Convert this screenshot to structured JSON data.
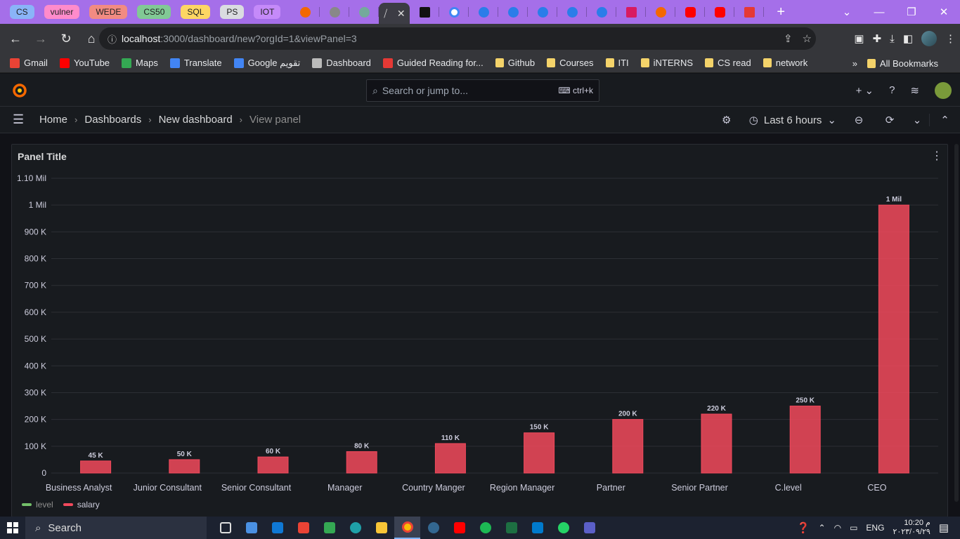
{
  "browser": {
    "tab_groups": [
      {
        "label": "CS",
        "color": "#8ab4f8"
      },
      {
        "label": "vulner",
        "color": "#ff8bcb"
      },
      {
        "label": "WEDE",
        "color": "#f28b82"
      },
      {
        "label": "CS50",
        "color": "#81c995"
      },
      {
        "label": "SQL",
        "color": "#fdd663"
      },
      {
        "label": "PS",
        "color": "#dadce0"
      },
      {
        "label": "IOT",
        "color": "#c58af9"
      }
    ],
    "url_host": "localhost",
    "url_rest": ":3000/dashboard/new?orgId=1&viewPanel=3",
    "all_bookmarks_label": "All Bookmarks"
  },
  "bookmarks": [
    {
      "label": "Gmail",
      "icon": "gmail-icon",
      "color": "#ea4335"
    },
    {
      "label": "YouTube",
      "icon": "youtube-icon",
      "color": "#ff0000"
    },
    {
      "label": "Maps",
      "icon": "maps-icon",
      "color": "#34a853"
    },
    {
      "label": "Translate",
      "icon": "translate-icon",
      "color": "#4285f4"
    },
    {
      "label": "Google تقويم",
      "icon": "calendar-icon",
      "color": "#4285f4"
    },
    {
      "label": "Dashboard",
      "icon": "dashboard-icon",
      "color": "#bbbbbb"
    },
    {
      "label": "Guided Reading for...",
      "icon": "s-icon",
      "color": "#e53935"
    },
    {
      "label": "Github",
      "icon": "folder-icon",
      "color": "#f4d36a"
    },
    {
      "label": "Courses",
      "icon": "folder-icon",
      "color": "#f4d36a"
    },
    {
      "label": "ITI",
      "icon": "folder-icon",
      "color": "#f4d36a"
    },
    {
      "label": "iNTERNS",
      "icon": "folder-icon",
      "color": "#f4d36a"
    },
    {
      "label": "CS read",
      "icon": "folder-icon",
      "color": "#f4d36a"
    },
    {
      "label": "network",
      "icon": "folder-icon",
      "color": "#f4d36a"
    }
  ],
  "grafana": {
    "search_placeholder": "Search or jump to...",
    "search_shortcut": "ctrl+k",
    "breadcrumbs": [
      "Home",
      "Dashboards",
      "New dashboard",
      "View panel"
    ],
    "time_range": "Last 6 hours",
    "panel_title": "Panel Title"
  },
  "chart_data": {
    "type": "bar",
    "categories": [
      "Business Analyst",
      "Junior Consultant",
      "Senior Consultant",
      "Manager",
      "Country Manger",
      "Region Manager",
      "Partner",
      "Senior Partner",
      "C.level",
      "CEO"
    ],
    "series": [
      {
        "name": "level",
        "color": "#73bf69",
        "values": []
      },
      {
        "name": "salary",
        "color": "#f2495c",
        "values": [
          45000,
          50000,
          60000,
          80000,
          110000,
          150000,
          200000,
          220000,
          250000,
          1000000
        ]
      }
    ],
    "value_labels": [
      "45 K",
      "50 K",
      "60 K",
      "80 K",
      "110 K",
      "150 K",
      "200 K",
      "220 K",
      "250 K",
      "1 Mil"
    ],
    "ylim": [
      0,
      1100000
    ],
    "y_ticks": [
      {
        "value": 0,
        "label": "0"
      },
      {
        "value": 100000,
        "label": "100 K"
      },
      {
        "value": 200000,
        "label": "200 K"
      },
      {
        "value": 300000,
        "label": "300 K"
      },
      {
        "value": 400000,
        "label": "400 K"
      },
      {
        "value": 500000,
        "label": "500 K"
      },
      {
        "value": 600000,
        "label": "600 K"
      },
      {
        "value": 700000,
        "label": "700 K"
      },
      {
        "value": 800000,
        "label": "800 K"
      },
      {
        "value": 900000,
        "label": "900 K"
      },
      {
        "value": 1000000,
        "label": "1 Mil"
      },
      {
        "value": 1100000,
        "label": "1.10 Mil"
      }
    ],
    "legend_position": "bottom-left",
    "grid": true
  },
  "taskbar": {
    "search_label": "Search",
    "language": "ENG",
    "time": "10:20 م",
    "date": "٢٠٢٣/٠٩/٢٩"
  }
}
